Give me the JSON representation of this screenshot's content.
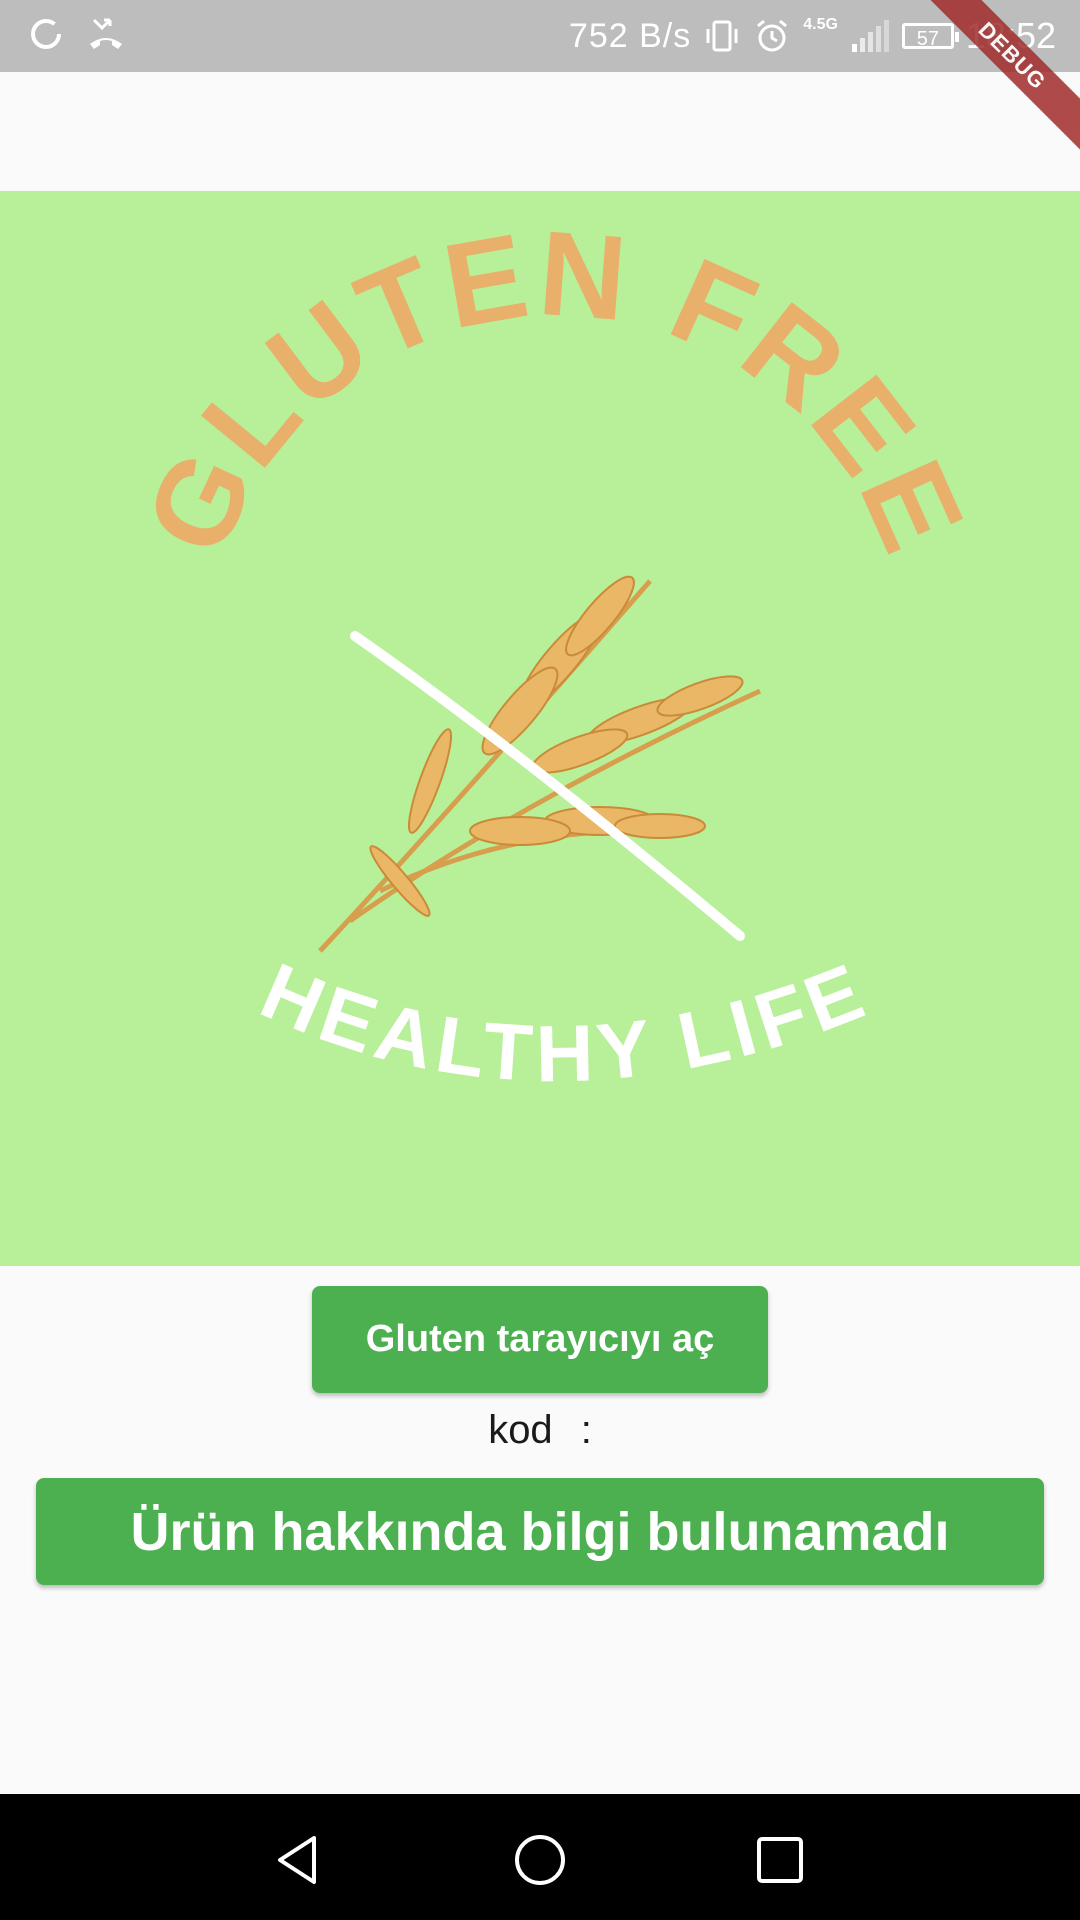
{
  "status_bar": {
    "net_speed": "752 B/s",
    "network_type": "4.5G",
    "battery_level": "57",
    "time": "18:52",
    "icons": [
      "loading-circle-icon",
      "missed-call-icon",
      "vibrate-icon",
      "alarm-icon",
      "signal-icon",
      "battery-icon"
    ]
  },
  "debug_banner": "DEBUG",
  "hero": {
    "arc_top_text": "GLUTEN FREE",
    "arc_bottom_text": "HEALTHY LIFE",
    "background_color": "#b8f09a",
    "top_text_color": "#e8b06a",
    "bottom_text_color": "#ffffff"
  },
  "actions": {
    "scan_button_label": "Gluten tarayıcıyı aç",
    "code_label": "kod",
    "code_separator": ":",
    "code_value": "",
    "result_label": "Ürün hakkında bilgi bulunamadı",
    "accent_color": "#4caf50"
  },
  "nav_bar": {
    "icons": [
      "back-icon",
      "home-icon",
      "recents-icon"
    ]
  }
}
